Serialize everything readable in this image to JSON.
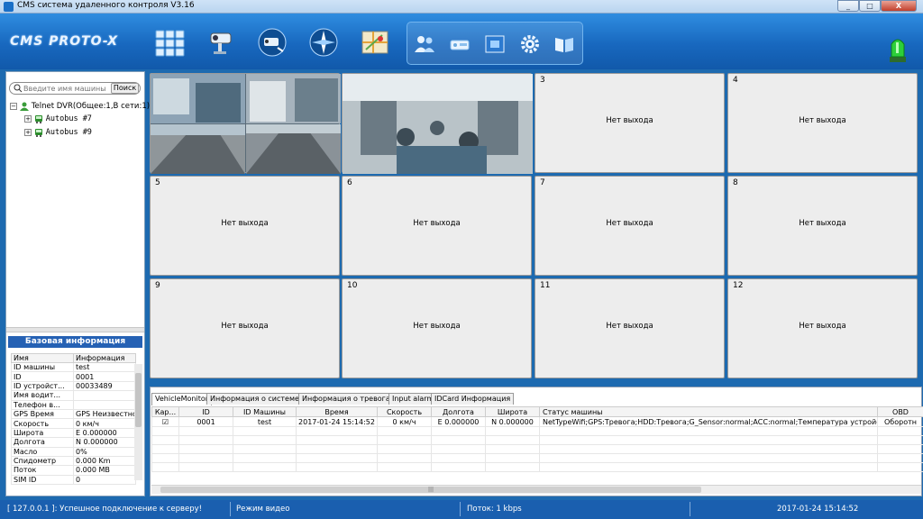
{
  "window": {
    "title": "CMS система удаленного контроля V3.16",
    "min": "_",
    "max": "□",
    "close": "X"
  },
  "toolbar": {
    "logo": "CMS PROTO-X",
    "buttons": [
      "grid-view-icon",
      "camera-icon",
      "playback-camera-icon",
      "compass-icon",
      "map-icon",
      "users-icon",
      "device-icon",
      "layout-icon",
      "settings-gear-icon",
      "manual-book-icon"
    ],
    "alarm_icon": "alarm-light-icon"
  },
  "search": {
    "placeholder": "Введите имя машины",
    "button": "Поиск"
  },
  "tree": {
    "root": "Telnet DVR(Общее:1,В сети:1)",
    "items": [
      "Autobus #7",
      "Autobus #9"
    ]
  },
  "info": {
    "title": "Базовая информация",
    "col_name": "Имя",
    "col_value": "Информация",
    "rows": [
      [
        "ID машины",
        "test"
      ],
      [
        "ID",
        "0001"
      ],
      [
        "ID устройст...",
        "00033489"
      ],
      [
        "Имя водит...",
        ""
      ],
      [
        "Телефон в...",
        ""
      ],
      [
        "GPS Время",
        "GPS Неизвестно"
      ],
      [
        "Скорость",
        "0 км/ч"
      ],
      [
        "Широта",
        "E 0.000000"
      ],
      [
        "Долгота",
        "N 0.000000"
      ],
      [
        "Масло",
        "0%"
      ],
      [
        "Спидометр",
        "0.000 Km"
      ],
      [
        "Поток",
        "0.000 MB"
      ],
      [
        "SIM ID",
        "0"
      ]
    ]
  },
  "grid": {
    "no_output": "Нет выхода",
    "numbers": [
      "3",
      "4",
      "5",
      "6",
      "7",
      "8",
      "9",
      "10",
      "11",
      "12"
    ]
  },
  "bottom": {
    "tabs": [
      "VehicleMonitor",
      "Информация о системе",
      "Информация о тревогах",
      "Input alarm",
      "IDCard Информация"
    ],
    "columns": [
      "Кар...",
      "ID",
      "ID Машины",
      "Время",
      "Скорость",
      "Долгота",
      "Широта",
      "Статус машины",
      "OBD"
    ],
    "row": {
      "checked": "☑",
      "id": "0001",
      "vehicle_id": "test",
      "time": "2017-01-24 15:14:52",
      "speed": "0 км/ч",
      "lon": "E 0.000000",
      "lat": "N 0.000000",
      "status": "NetTypeWifi;GPS:Тревога;HDD:Тревога;G_Sensor:normal;ACC:normal;Температура устройства:...",
      "obd": "Оборотн"
    }
  },
  "statusbar": {
    "connection": "[ 127.0.0.1 ]: Успешное подключение к серверу!",
    "mode": "Режим видео",
    "flow": "Поток: 1 kbps",
    "time": "2017-01-24 15:14:52"
  },
  "colors": {
    "toolbar": "#1868bf",
    "status": "#1a5faf",
    "header": "#2561b4"
  }
}
